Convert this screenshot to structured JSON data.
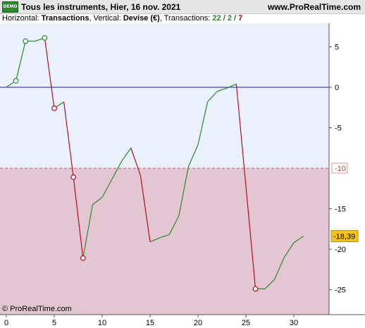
{
  "header": {
    "logo_text": "DEMO",
    "title": "Tous les instruments, Hier, 16 nov. 2021",
    "site": "www.ProRealTime.com"
  },
  "info": {
    "h_label": "Horizontal:",
    "h_value": "Transactions",
    "sep1": ",",
    "v_label": "Vertical:",
    "v_value": "Devise (€)",
    "sep2": ",",
    "t_label": "Transactions:",
    "t_total": "22",
    "slash1": "/",
    "t_green": "2",
    "slash2": "/",
    "t_red": "7"
  },
  "copyright": "© ProRealTime.com",
  "colors": {
    "up": "#2a8a2a",
    "down": "#b01020",
    "zero_line": "#1a1a8c",
    "limit_line": "#c06060",
    "upper_zone": "#eaf0fc",
    "lower_zone": "#e4c6d2",
    "last_value_bg": "#f5c518"
  },
  "chart_data": {
    "type": "line",
    "x_ticks": [
      0,
      5,
      10,
      15,
      20,
      25,
      30
    ],
    "x_tick_labels": [
      "0",
      "5",
      "10",
      "15",
      "20",
      "25",
      "30"
    ],
    "y_ticks": [
      5,
      0,
      -5,
      -15,
      -20,
      -25
    ],
    "y_tick_labels": [
      "5",
      "0",
      "-5",
      "-15",
      "-20",
      "-25"
    ],
    "xlim": [
      0,
      34
    ],
    "ylim": [
      -28,
      8
    ],
    "zero_level": 0,
    "limit_level": -10,
    "limit_label": "-10",
    "last_value": -18.39,
    "last_value_label": "-18,39",
    "points": [
      {
        "x": 0,
        "y": 0
      },
      {
        "x": 1,
        "y": 0.8
      },
      {
        "x": 2,
        "y": 5.7
      },
      {
        "x": 3,
        "y": 5.7
      },
      {
        "x": 4,
        "y": 6.1
      },
      {
        "x": 5,
        "y": -2.6
      },
      {
        "x": 6,
        "y": -1.8
      },
      {
        "x": 7,
        "y": -11.1
      },
      {
        "x": 8,
        "y": -21.1
      },
      {
        "x": 9,
        "y": -14.5
      },
      {
        "x": 10,
        "y": -13.6
      },
      {
        "x": 11,
        "y": -11.4
      },
      {
        "x": 12,
        "y": -9.2
      },
      {
        "x": 13,
        "y": -7.5
      },
      {
        "x": 14,
        "y": -10.9
      },
      {
        "x": 15,
        "y": -19.1
      },
      {
        "x": 16,
        "y": -18.6
      },
      {
        "x": 17,
        "y": -18.2
      },
      {
        "x": 18,
        "y": -15.9
      },
      {
        "x": 19,
        "y": -9.8
      },
      {
        "x": 20,
        "y": -7.1
      },
      {
        "x": 21,
        "y": -1.8
      },
      {
        "x": 22,
        "y": -0.5
      },
      {
        "x": 23,
        "y": -0.1
      },
      {
        "x": 24,
        "y": 0.4
      },
      {
        "x": 26,
        "y": -24.9
      },
      {
        "x": 27,
        "y": -24.9
      },
      {
        "x": 28,
        "y": -23.7
      },
      {
        "x": 29,
        "y": -21.0
      },
      {
        "x": 30,
        "y": -19.2
      },
      {
        "x": 31,
        "y": -18.4
      }
    ],
    "markers": [
      {
        "x": 1,
        "y": 0.8,
        "type": "up"
      },
      {
        "x": 2,
        "y": 5.7,
        "type": "up"
      },
      {
        "x": 4,
        "y": 6.1,
        "type": "up"
      },
      {
        "x": 5,
        "y": -2.6,
        "type": "down"
      },
      {
        "x": 7,
        "y": -11.1,
        "type": "down"
      },
      {
        "x": 8,
        "y": -21.1,
        "type": "down"
      },
      {
        "x": 26,
        "y": -24.9,
        "type": "down"
      }
    ]
  }
}
